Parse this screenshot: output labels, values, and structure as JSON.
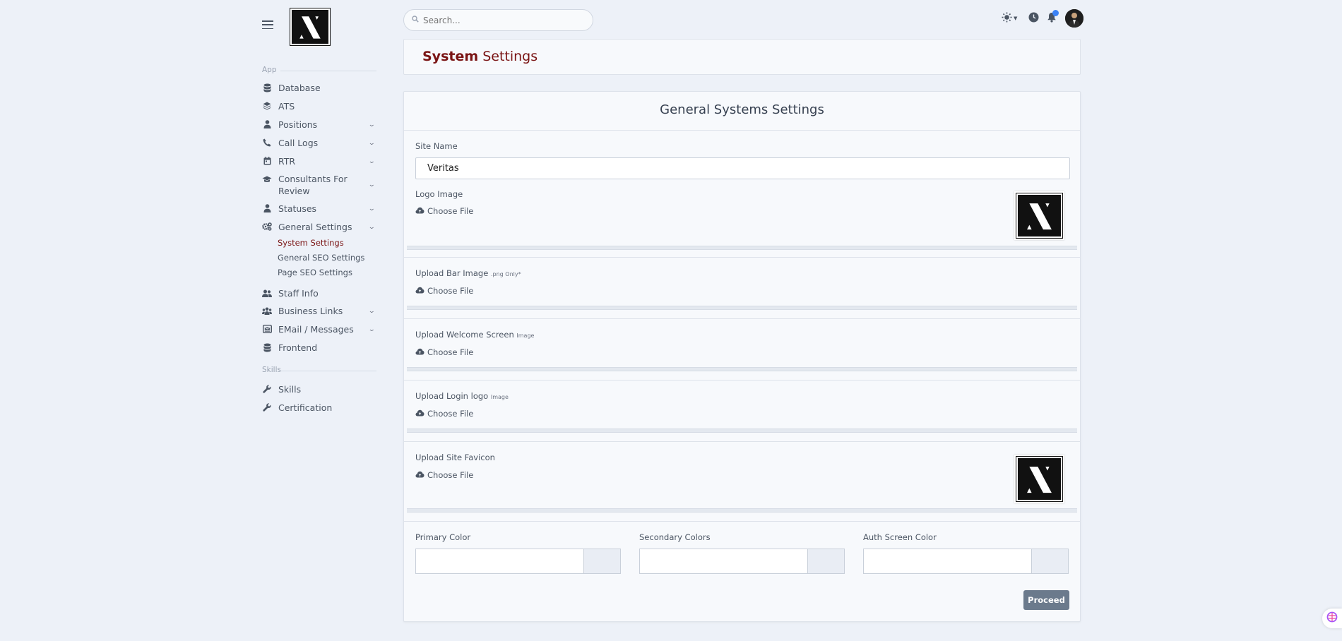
{
  "search": {
    "placeholder": "Search..."
  },
  "sidebar": {
    "sections": [
      {
        "label": "App"
      },
      {
        "label": "Skills"
      }
    ],
    "items": [
      {
        "label": "Database",
        "icon": "database-icon",
        "has_children": false
      },
      {
        "label": "ATS",
        "icon": "layers-icon",
        "has_children": false
      },
      {
        "label": "Positions",
        "icon": "user-icon",
        "has_children": true
      },
      {
        "label": "Call Logs",
        "icon": "phone-icon",
        "has_children": true
      },
      {
        "label": "RTR",
        "icon": "calendar-icon",
        "has_children": true
      },
      {
        "label": "Consultants For Review",
        "icon": "graduation-cap-icon",
        "has_children": true
      },
      {
        "label": "Statuses",
        "icon": "user-icon",
        "has_children": true
      },
      {
        "label": "General Settings",
        "icon": "cogs-icon",
        "has_children": true,
        "expanded": true
      },
      {
        "label": "Staff Info",
        "icon": "users-icon",
        "has_children": false
      },
      {
        "label": "Business Links",
        "icon": "users-group-icon",
        "has_children": true
      },
      {
        "label": "EMail / Messages",
        "icon": "mail-bulk-icon",
        "has_children": true
      },
      {
        "label": "Frontend",
        "icon": "database-icon",
        "has_children": false
      },
      {
        "label": "Skills",
        "icon": "wrench-icon",
        "has_children": false
      },
      {
        "label": "Certification",
        "icon": "wrench-icon",
        "has_children": false
      }
    ],
    "sub_items": [
      {
        "label": "System Settings",
        "active": true
      },
      {
        "label": "General SEO Settings",
        "active": false
      },
      {
        "label": "Page SEO Settings",
        "active": false
      }
    ]
  },
  "header": {
    "title_bold": "System",
    "title_rest": "Settings"
  },
  "form": {
    "title": "General Systems Settings",
    "site_name_label": "Site Name",
    "site_name_value": "Veritas",
    "logo_label": "Logo Image",
    "bar_label": "Upload Bar Image",
    "bar_hint": ".png Only*",
    "welcome_label": "Upload Welcome Screen",
    "welcome_hint": "Image",
    "login_label": "Upload Login logo",
    "login_hint": "Image",
    "favicon_label": "Upload Site Favicon",
    "choose_file": "Choose File",
    "primary_color_label": "Primary Color",
    "secondary_color_label": "Secondary Colors",
    "auth_color_label": "Auth Screen Color",
    "primary_color_value": "",
    "secondary_color_value": "",
    "auth_color_value": "",
    "proceed_label": "Proceed"
  },
  "colors": {
    "brand": "#7a1414",
    "accent": "#3b82f6",
    "button": "#6b7a8c"
  }
}
